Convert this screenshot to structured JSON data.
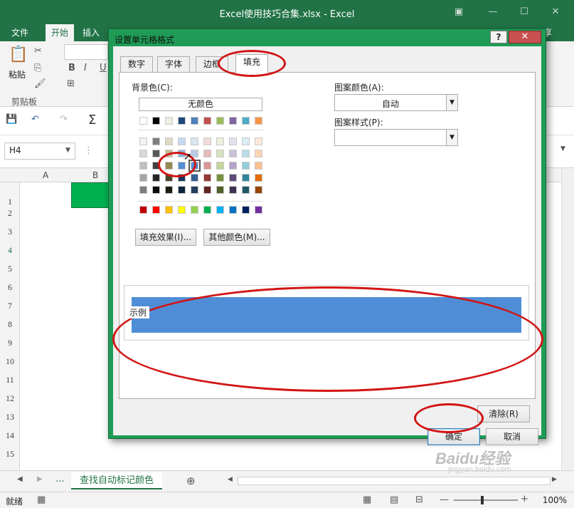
{
  "window": {
    "title": "Excel使用技巧合集.xlsx - Excel"
  },
  "ribbon": {
    "tabs": [
      {
        "label": "文件"
      },
      {
        "label": "开始"
      },
      {
        "label": "插入"
      }
    ],
    "share_label": "享",
    "paste_label": "粘贴",
    "clipboard_group": "剪贴板"
  },
  "formula_bar": {
    "name_box": "H4"
  },
  "grid": {
    "columns": [
      "A",
      "B"
    ],
    "rows": [
      "1",
      "2",
      "3",
      "4",
      "5",
      "6",
      "7",
      "8",
      "9",
      "10",
      "11",
      "12",
      "13",
      "14",
      "15"
    ],
    "selected_row": "4",
    "highlight_color": "#00B050"
  },
  "sheet": {
    "tab_label": "查找自动标记颜色",
    "ellipsis": "..."
  },
  "status": {
    "ready": "就绪",
    "zoom": "100%"
  },
  "dialog": {
    "title": "设置单元格格式",
    "help": "?",
    "close": "✕",
    "tabs": [
      {
        "label": "数字"
      },
      {
        "label": "字体"
      },
      {
        "label": "边框"
      },
      {
        "label": "填充"
      }
    ],
    "background_label": "背景色(C):",
    "no_color": "无颜色",
    "fill_effects": "填充效果(I)...",
    "more_colors": "其他颜色(M)...",
    "pattern_color_label": "图案颜色(A):",
    "pattern_color_value": "自动",
    "pattern_style_label": "图案样式(P):",
    "pattern_style_value": "",
    "sample_label": "示例",
    "sample_color": "#4F8ED6",
    "clear": "清除(R)",
    "ok": "确定",
    "cancel": "取消"
  },
  "palette": {
    "theme_header": [
      "#FFFFFF",
      "#000000",
      "#EEECE1",
      "#1F497D",
      "#4F81BD",
      "#C0504D",
      "#9BBB59",
      "#8064A2",
      "#4BACC6",
      "#F79646"
    ],
    "theme_shades": [
      [
        "#F2F2F2",
        "#7F7F7F",
        "#DDD9C3",
        "#C6D9F0",
        "#DBE5F1",
        "#F2DCDB",
        "#EBF1DD",
        "#E5E0EC",
        "#DBEEF3",
        "#FDEADA"
      ],
      [
        "#D8D8D8",
        "#595959",
        "#C4BD97",
        "#8DB3E2",
        "#B8CCE4",
        "#E5B9B7",
        "#D7E3BC",
        "#CCC1D9",
        "#B7DDE8",
        "#FBD5B5"
      ],
      [
        "#BFBFBF",
        "#3F3F3F",
        "#938953",
        "#548DD4",
        "#4F8ED6",
        "#D99694",
        "#C3D69B",
        "#B2A2C7",
        "#92CDDC",
        "#FAC08F"
      ],
      [
        "#A5A5A5",
        "#262626",
        "#494429",
        "#17365D",
        "#366092",
        "#953734",
        "#76923C",
        "#5F497A",
        "#31859B",
        "#E36C09"
      ],
      [
        "#7F7F7F",
        "#0C0C0C",
        "#1D1B10",
        "#0F243E",
        "#244061",
        "#632423",
        "#4F6128",
        "#3F3151",
        "#205867",
        "#974806"
      ]
    ],
    "standard": [
      "#C00000",
      "#FF0000",
      "#FFC000",
      "#FFFF00",
      "#92D050",
      "#00B050",
      "#00B0F0",
      "#0070C0",
      "#002060",
      "#7030A0"
    ],
    "selected": "#4F8ED6"
  },
  "watermark": {
    "brand": "Baidu经验",
    "url": "jingyan.baidu.com"
  }
}
